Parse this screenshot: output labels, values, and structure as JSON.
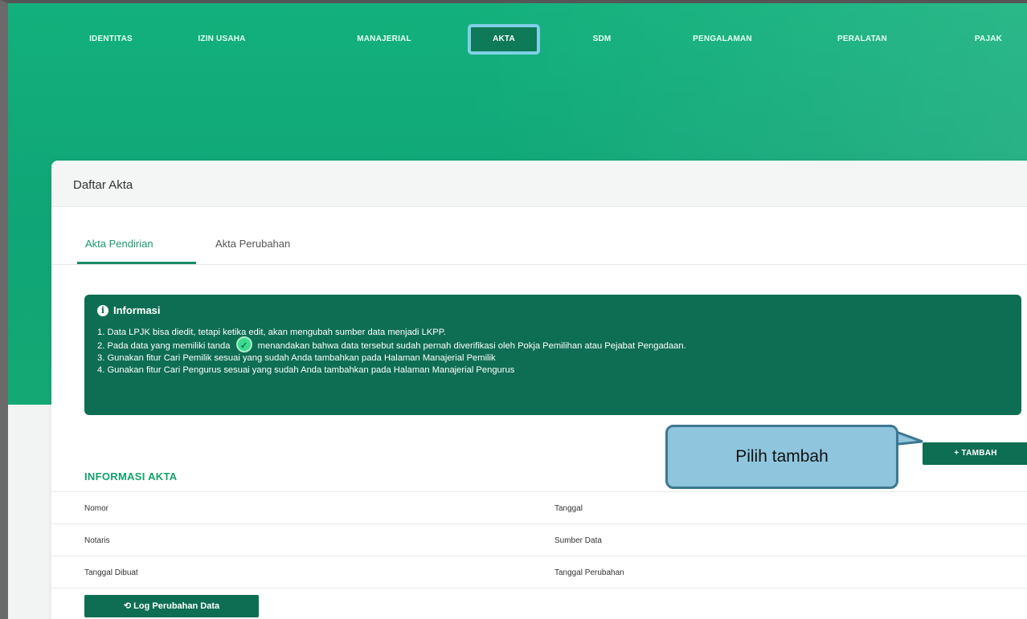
{
  "nav": {
    "items": [
      "IDENTITAS",
      "IZIN USAHA",
      "MANAJERIAL",
      "AKTA",
      "SDM",
      "PENGALAMAN",
      "PERALATAN",
      "PAJAK"
    ],
    "active": "AKTA"
  },
  "card": {
    "title": "Daftar Akta"
  },
  "tabs": [
    {
      "label": "Akta Pendirian",
      "active": true
    },
    {
      "label": "Akta Perubahan",
      "active": false
    }
  ],
  "info": {
    "heading": "Informasi",
    "line1": "1. Data LPJK bisa diedit, tetapi ketika edit, akan mengubah sumber data menjadi LKPP.",
    "line2_pre": "2. Pada data yang memiliki tanda",
    "line2_post": "menandakan bahwa data tersebut sudah pernah diverifikasi oleh Pokja Pemilihan atau Pejabat Pengadaan.",
    "line3": "3. Gunakan fitur Cari Pemilik sesuai yang sudah Anda tambahkan pada Halaman Manajerial Pemilik",
    "line4": "4. Gunakan fitur Cari Pengurus sesuai yang sudah Anda tambahkan pada Halaman Manajerial Pengurus"
  },
  "buttons": {
    "tambah": "+ TAMBAH",
    "log": "⟲ Log Perubahan Data"
  },
  "section": {
    "title": "INFORMASI AKTA"
  },
  "fields": {
    "nomor": "Nomor",
    "tanggal": "Tanggal",
    "notaris": "Notaris",
    "sumber_data": "Sumber Data",
    "tanggal_dibuat": "Tanggal Dibuat",
    "tanggal_perubahan": "Tanggal Perubahan"
  },
  "callout": {
    "text": "Pilih tambah"
  },
  "colors": {
    "primary": "#0e6e53",
    "hero": "#12b07c",
    "accent": "#15a06e",
    "callout": "#8fc6dd"
  }
}
